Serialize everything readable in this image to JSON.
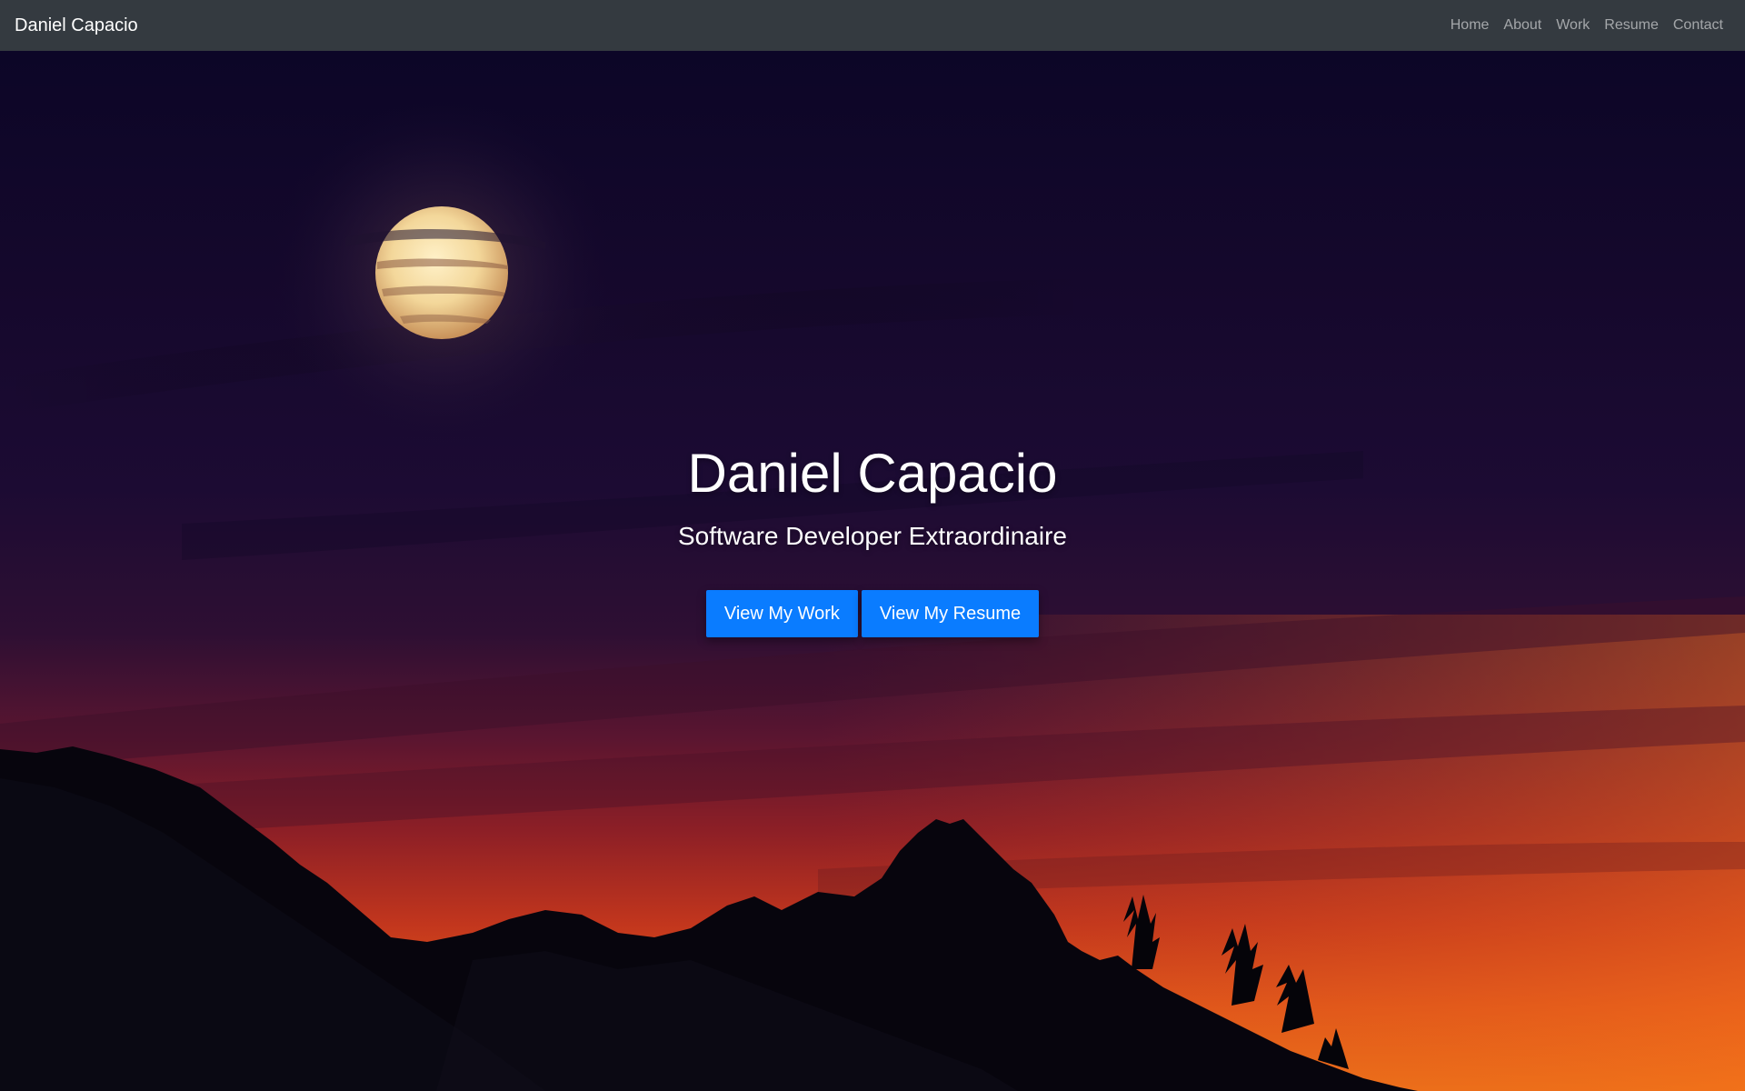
{
  "navbar": {
    "brand": "Daniel Capacio",
    "links": [
      {
        "label": "Home"
      },
      {
        "label": "About"
      },
      {
        "label": "Work"
      },
      {
        "label": "Resume"
      },
      {
        "label": "Contact"
      }
    ]
  },
  "hero": {
    "title": "Daniel Capacio",
    "subtitle": "Software Developer Extraordinaire",
    "buttons": [
      {
        "label": "View My Work"
      },
      {
        "label": "View My Resume"
      }
    ],
    "background_image": "night-sky-full-moon-mountains-sunset-photo"
  },
  "colors": {
    "navbar": "#343a40",
    "button": "#0a7cff",
    "nav_link": "rgba(255,255,255,0.55)",
    "text": "#ffffff"
  }
}
